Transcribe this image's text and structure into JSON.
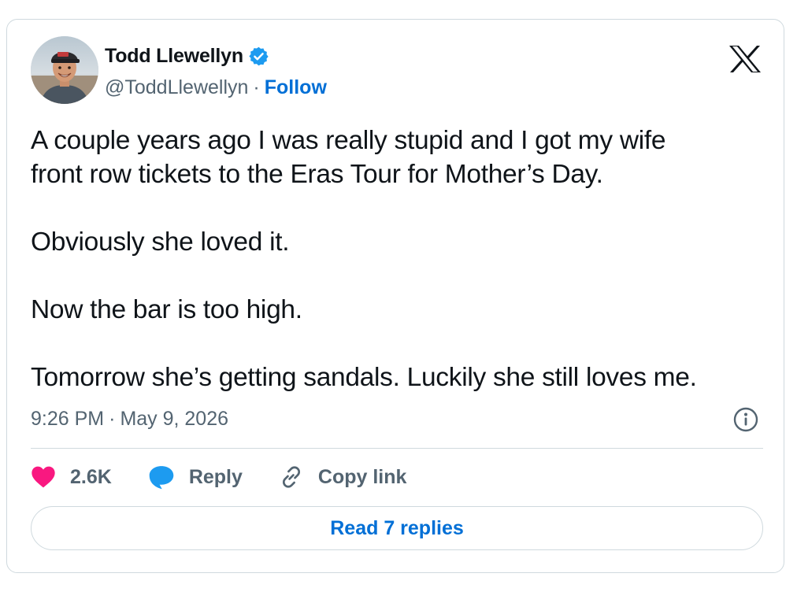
{
  "author": {
    "display_name": "Todd Llewellyn",
    "handle": "@ToddLlewellyn",
    "separator": "·",
    "follow_label": "Follow",
    "verified": true,
    "verified_color": "#1d9bf0"
  },
  "tweet": {
    "paragraphs": [
      [
        "A couple years ago I was really stupid and I got my wife",
        "front row tickets to the Eras Tour for Mother’s Day."
      ],
      [
        "Obviously she loved it."
      ],
      [
        "Now the bar is too high."
      ],
      [
        "Tomorrow she’s getting sandals. Luckily she still loves me."
      ]
    ],
    "time": "9:26 PM",
    "date_separator": "·",
    "date": "May 9, 2026"
  },
  "actions": {
    "like_count": "2.6K",
    "reply_label": "Reply",
    "copy_link_label": "Copy link",
    "read_replies_label": "Read 7 replies"
  },
  "icons": {
    "brand": "x-logo-icon",
    "info": "info-icon",
    "like": "heart-icon",
    "reply": "speech-bubble-icon",
    "copy": "link-icon",
    "verified": "verified-badge-icon"
  },
  "colors": {
    "like": "#f91880",
    "reply": "#1d9bf0",
    "link": "#006fd6",
    "muted": "#536471",
    "border": "#cfd9de"
  }
}
